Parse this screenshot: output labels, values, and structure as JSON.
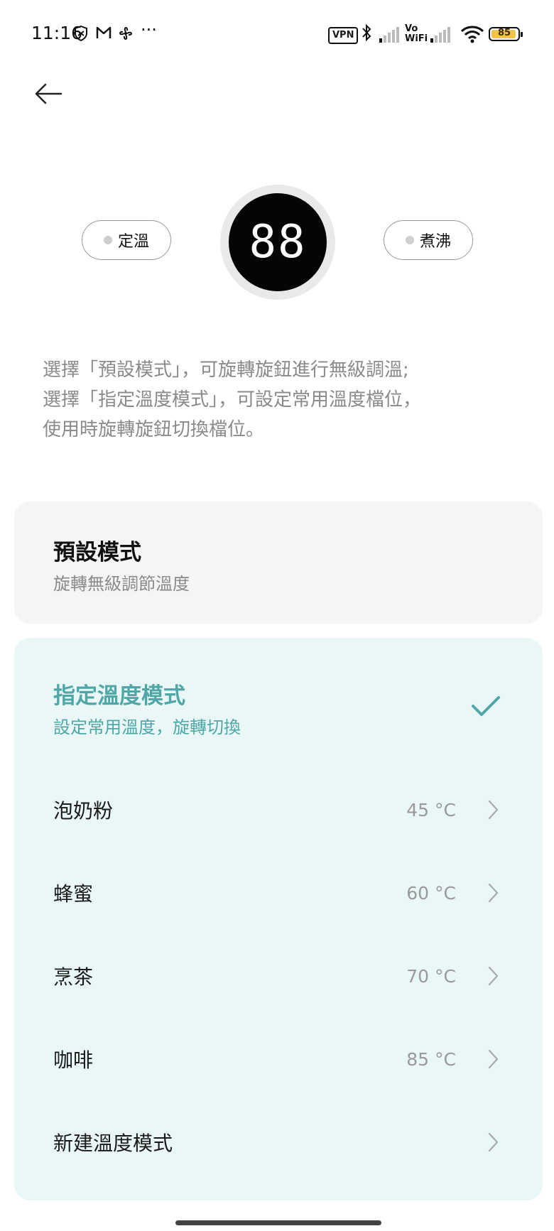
{
  "status_bar": {
    "time": "11:16",
    "more": "···",
    "vpn": "VPN",
    "vowifi": "Vo\nWiFi",
    "battery": "85",
    "icons": [
      "shield-icon",
      "gmail-icon",
      "pinwheel-icon",
      "more-icon",
      "vpn-icon",
      "bluetooth-icon",
      "signal-icon",
      "vowifi-icon",
      "signal-icon",
      "wifi-icon",
      "battery-icon"
    ]
  },
  "device": {
    "left_pill": "定溫",
    "right_pill": "煮沸",
    "display": "88"
  },
  "description": {
    "line1": "選擇「預設模式」，可旋轉旋鈕進行無級調溫;",
    "line2": "選擇「指定溫度模式」，可設定常用溫度檔位，",
    "line3": "使用時旋轉旋鈕切換檔位。"
  },
  "preset_mode": {
    "title": "預設模式",
    "subtitle": "旋轉無級調節溫度"
  },
  "custom_mode": {
    "title": "指定溫度模式",
    "subtitle": "設定常用溫度，旋轉切換",
    "selected": true,
    "accent": "#4fa7a7",
    "items": [
      {
        "label": "泡奶粉",
        "value": "45 °C"
      },
      {
        "label": "蜂蜜",
        "value": "60 °C"
      },
      {
        "label": "烹茶",
        "value": "70 °C"
      },
      {
        "label": "咖啡",
        "value": "85 °C"
      },
      {
        "label": "新建溫度模式",
        "value": ""
      }
    ]
  }
}
